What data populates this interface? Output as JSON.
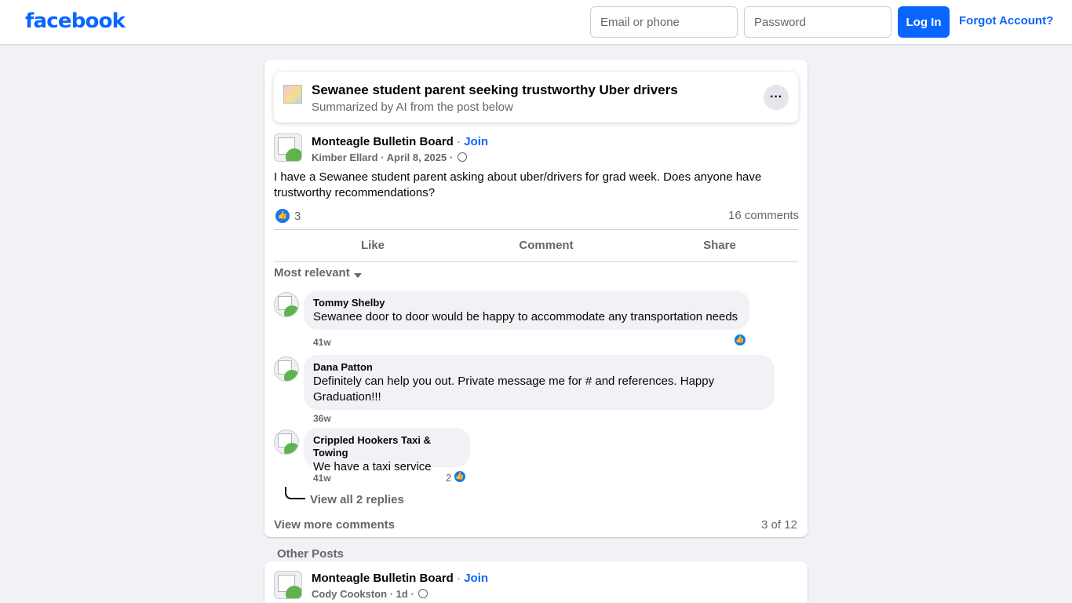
{
  "header": {
    "logo": "facebook",
    "email_placeholder": "Email or phone",
    "password_placeholder": "Password",
    "login_label": "Log In",
    "forgot_label": "Forgot Account?"
  },
  "ai_summary": {
    "title": "Sewanee student parent seeking trustworthy Uber drivers",
    "subtitle": "Summarized by AI from the post below",
    "more_label": "···"
  },
  "post": {
    "group": "Monteagle Bulletin Board",
    "separator": "·",
    "join_label": "Join",
    "author": "Kimber Ellard",
    "date": "April 8, 2025",
    "text": "I have a Sewanee student parent asking about uber/drivers for grad week.  Does anyone have trustworthy recommendations?",
    "reaction_count": "3",
    "comments_count": "16 comments"
  },
  "actions": {
    "like": "Like",
    "comment": "Comment",
    "share": "Share"
  },
  "sort_label": "Most relevant",
  "comments": [
    {
      "author": "Tommy Shelby",
      "text": "Sewanee door to door would be happy to accommodate any transportation needs",
      "time": "41w"
    },
    {
      "author": "Dana Patton",
      "text": "Definitely can help you out. Private message me for # and references. Happy Graduation!!!",
      "time": "36w"
    },
    {
      "author": "Crippled Hookers Taxi & Towing",
      "text": "We have a taxi service",
      "time": "41w",
      "likes": "2"
    }
  ],
  "view_replies": "View all 2 replies",
  "view_more": "View more comments",
  "page_count": "3 of 12",
  "other_posts": {
    "label": "Other Posts",
    "group": "Monteagle Bulletin Board",
    "join_label": "Join",
    "author": "Cody Cookston",
    "date": "1d"
  },
  "colors": {
    "brand": "#0866ff",
    "background": "#f0f2f5",
    "secondary_text": "#65676b"
  }
}
